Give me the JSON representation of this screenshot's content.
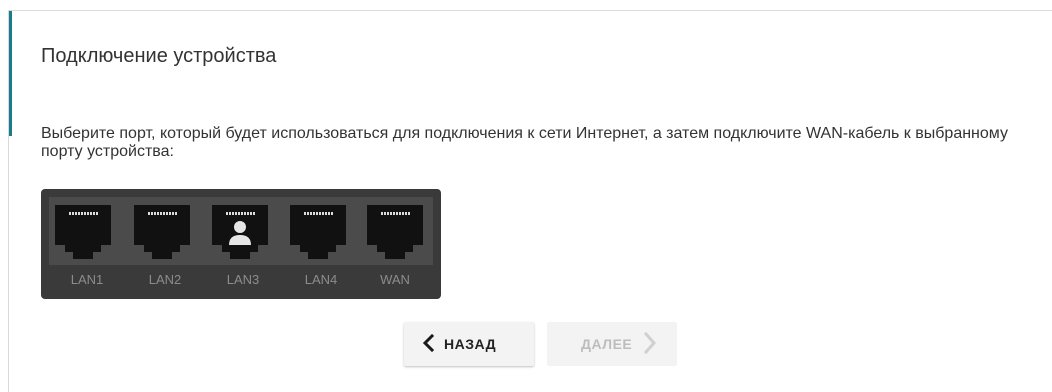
{
  "page": {
    "title": "Подключение устройства",
    "instructions": "Выберите порт, который будет использоваться для подключения к сети Интернет, а затем подключите WAN-кабель к выбранному порту устройства:"
  },
  "ports": [
    {
      "label": "LAN1",
      "selected": false
    },
    {
      "label": "LAN2",
      "selected": false
    },
    {
      "label": "LAN3",
      "selected": true
    },
    {
      "label": "LAN4",
      "selected": false
    },
    {
      "label": "WAN",
      "selected": false
    }
  ],
  "buttons": {
    "back_label": "НАЗАД",
    "next_label": "ДАЛЕЕ"
  },
  "icons": {
    "back": "chevron-left-icon",
    "next": "chevron-right-icon",
    "user": "user-icon"
  },
  "colors": {
    "accent": "#1b7a8c",
    "panel": "#3a3a3a",
    "port": "#111111"
  }
}
